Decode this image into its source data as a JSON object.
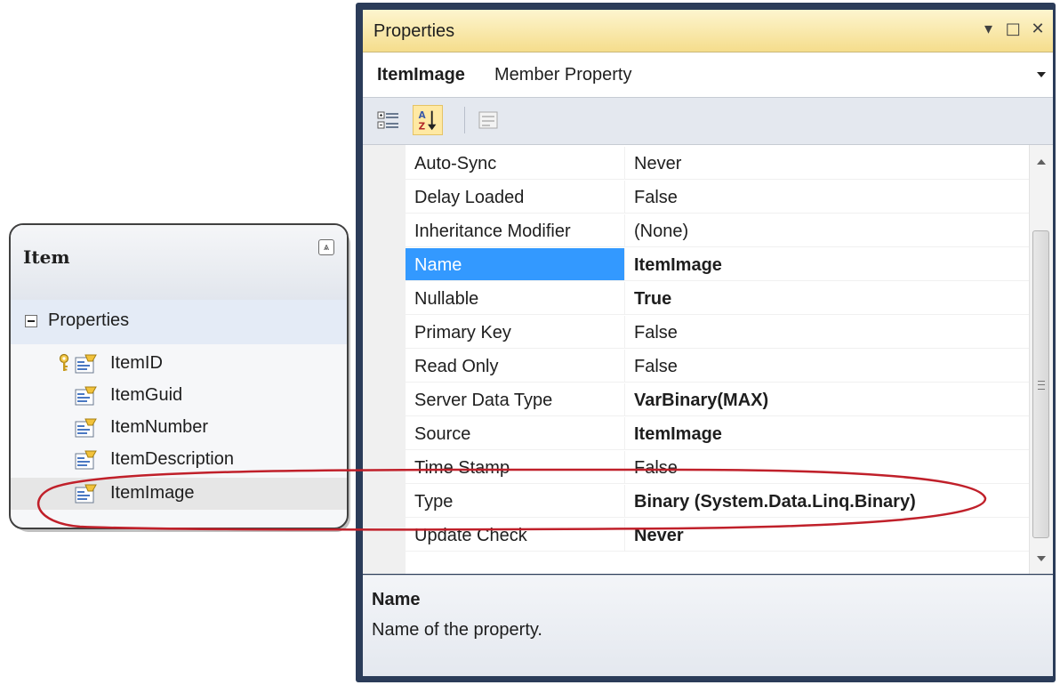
{
  "entity": {
    "title": "Item",
    "section_label": "Properties",
    "properties": [
      {
        "label": "ItemID",
        "key": true
      },
      {
        "label": "ItemGuid"
      },
      {
        "label": "ItemNumber"
      },
      {
        "label": "ItemDescription"
      },
      {
        "label": "ItemImage",
        "selected": true
      }
    ]
  },
  "properties_window": {
    "title": "Properties",
    "selected_object_name": "ItemImage",
    "selected_object_type": "Member Property",
    "rows": [
      {
        "name": "Auto-Sync",
        "value": "Never"
      },
      {
        "name": "Delay Loaded",
        "value": "False"
      },
      {
        "name": "Inheritance Modifier",
        "value": "(None)"
      },
      {
        "name": "Name",
        "value": "ItemImage",
        "bold": true,
        "selected": true
      },
      {
        "name": "Nullable",
        "value": "True",
        "bold": true
      },
      {
        "name": "Primary Key",
        "value": "False"
      },
      {
        "name": "Read Only",
        "value": "False"
      },
      {
        "name": "Server Data Type",
        "value": "VarBinary(MAX)",
        "bold": true
      },
      {
        "name": "Source",
        "value": "ItemImage",
        "bold": true
      },
      {
        "name": "Time Stamp",
        "value": "False"
      },
      {
        "name": "Type",
        "value": "Binary (System.Data.Linq.Binary)",
        "bold": true
      },
      {
        "name": "Update Check",
        "value": "Never",
        "bold": true
      }
    ],
    "description": {
      "title": "Name",
      "text": "Name of the property."
    }
  },
  "colors": {
    "title_bar": "#f5dd8c",
    "selected_row": "#3399ff",
    "highlight_ellipse": "#c0202a",
    "window_frame": "#2b3c59"
  }
}
